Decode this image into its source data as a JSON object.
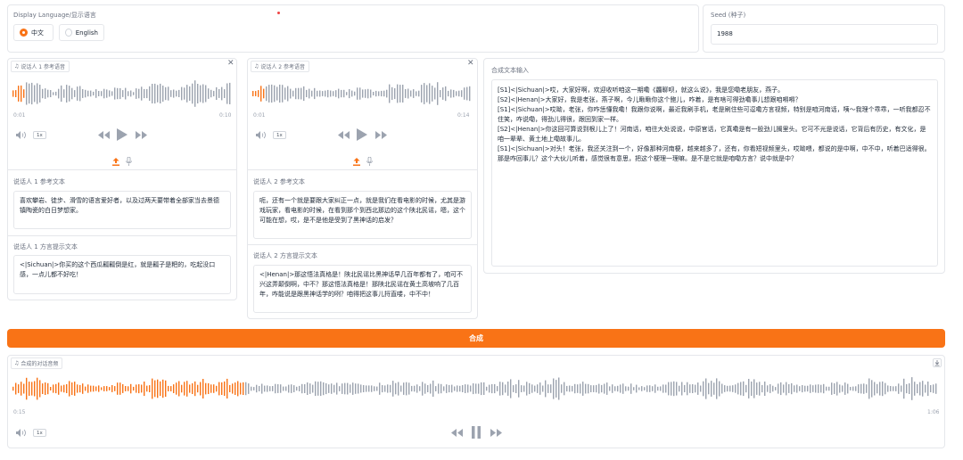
{
  "language": {
    "label": "Display Language/显示语言",
    "options": [
      {
        "label": "中文",
        "selected": true
      },
      {
        "label": "English",
        "selected": false
      }
    ]
  },
  "seed": {
    "label": "Seed (种子)",
    "value": "1988"
  },
  "speaker1": {
    "audio_label": "说话人 1 参考语音",
    "time_start": "0:01",
    "time_end": "0:10",
    "speed": "1x",
    "ref_text_label": "说话人 1 参考文本",
    "ref_text": "喜欢攀岩、徒步、滑雪的语言爱好者，以及过两天要带着全部家当去景德镇陶瓷的白日梦想家。",
    "dialect_label": "说话人 1 方言提示文本",
    "dialect_text": "<|Sichuan|>你买的这个西瓜瓤瓤倒是红，就是瓤子是粑的，吃起没口感，一点儿都不好吃！"
  },
  "speaker2": {
    "audio_label": "说话人 2 参考语音",
    "time_start": "0:01",
    "time_end": "0:14",
    "speed": "1x",
    "ref_text_label": "说话人 2 参考文本",
    "ref_text": "呃，还有一个就是要跟大家纠正一点，就是我们在看电影的时候，尤其是游戏玩家，看电影的时候，在看到那个到西北那边的这个陕北民谣，嗯，这个可能在想，哎，是不是他是受到了黑神话的启发？",
    "dialect_label": "说话人 2 方言提示文本",
    "dialect_text": "<|Henan|>那这悟法真格是！陕北民谣比黑神话早几百年都有了，咱可不兴这弄颠倒啊，中不？那这悟法真格是！那陕北民谣在黄土高坡响了几百年，咋能说是跟黑神话学的咧？咱得把这事儿捋直喽，中不中！"
  },
  "synth_input": {
    "label": "合成文本输入",
    "lines": [
      "[S1]<|Sichuan|>哎，大家好啊，欢迎收听咱这一期嘞《龘聊呗，就这么说》，我是您嘞老朋友，燕子。",
      "[S2]<|Henan|>大家好，我是老张，燕子啊，今儿瞅瞅你这个鲍儿，咋着，是有啥可得劲嘞事儿想跟咱嘚嘚？",
      "[S1]<|Sichuan|>哎呦，老张，你咋恁懂我嘞！我跟你说啊，最近我刷手机，老是刷住些可逗嘞方言视频，特别是咱河南话，咦～我理个乖乖，一听我都忍不住笑，咋说嘞，得劲儿得很，跟回到家一样。",
      "[S2]<|Henan|>你这回可算说到根儿上了！河南话，咱往大处说说，中原官话，它真嘞是有一股劲儿搁里头。它可不光是说话，它背后有历史，有文化，是咱一辈辈、黄土地上嘞故事儿。",
      "[S1]<|Sichuan|>对头！老张，我还关注到一个，好像那种河南梗，越来越多了，还有，你看短视频里头，哎呦喂，都说的是中啊，中不中，听着巴适得很。那是咋回事儿？这个大伙儿听着，感觉很有意思，把这个梗理一理嘛。是不是它就是咱嘞方言？说中就是中？"
    ]
  },
  "synth_button": "合成",
  "output": {
    "audio_label": "合成的对话音频",
    "time_start": "0:15",
    "time_end": "1:06",
    "speed": "1x"
  },
  "colors": {
    "accent": "#f97316",
    "wave_inactive": "#9ca3af",
    "border": "#e5e7eb"
  },
  "icons": {
    "audio": "music-note-icon",
    "close": "close-icon",
    "upload": "upload-icon",
    "mic": "microphone-icon",
    "volume": "volume-icon",
    "rewind": "rewind-icon",
    "play": "play-icon",
    "pause": "pause-icon",
    "forward": "fast-forward-icon",
    "download": "download-icon"
  }
}
